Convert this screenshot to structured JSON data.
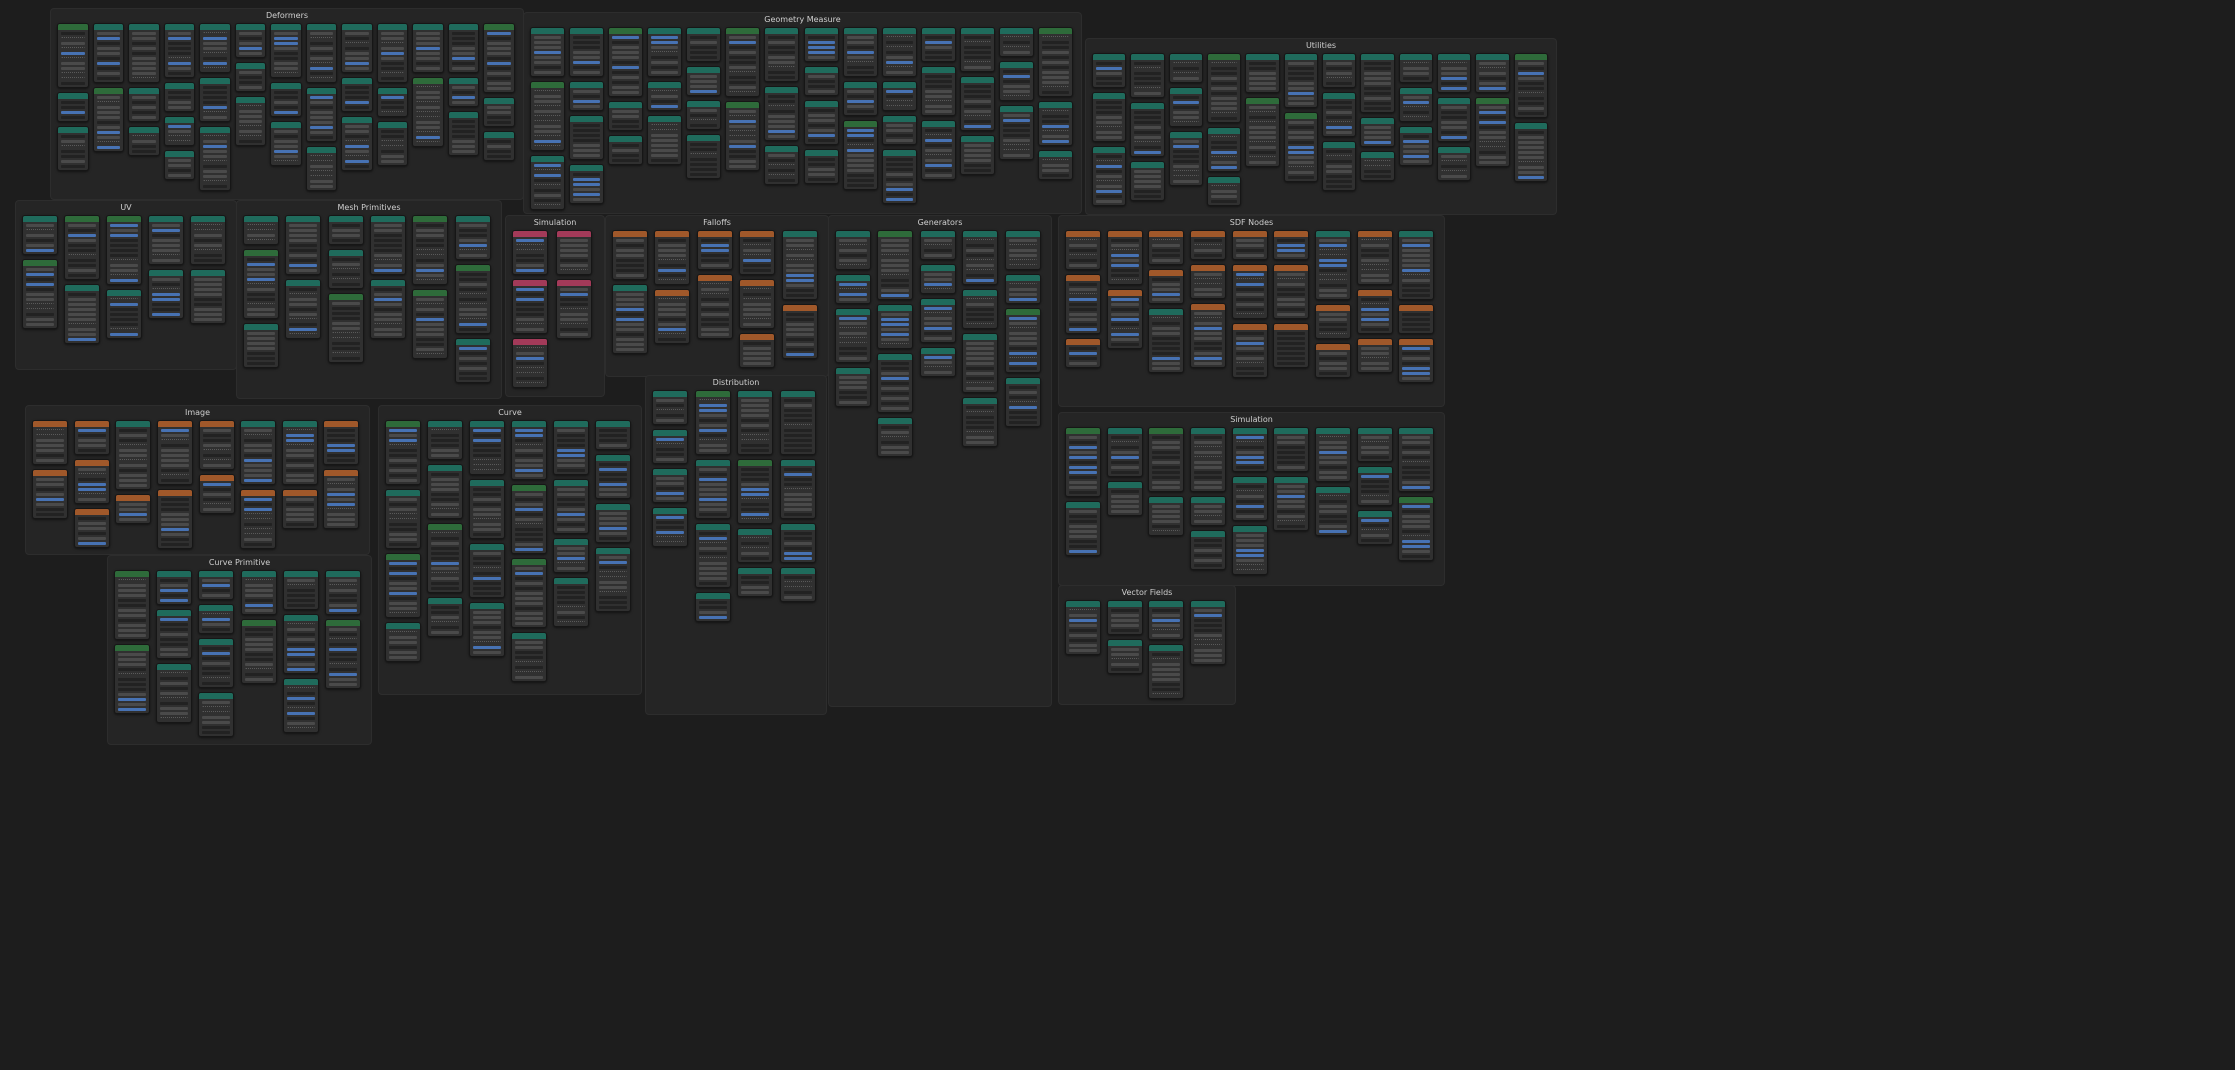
{
  "canvas": {
    "frames": [
      {
        "title": "Deformers"
      },
      {
        "title": "Geometry Measure"
      },
      {
        "title": "Utilities"
      },
      {
        "title": "UV"
      },
      {
        "title": "Mesh Primitives"
      },
      {
        "title": "Simulation"
      },
      {
        "title": "Falloffs"
      },
      {
        "title": "Generators"
      },
      {
        "title": "SDF Nodes"
      },
      {
        "title": "Distribution"
      },
      {
        "title": "Image"
      },
      {
        "title": "Curve"
      },
      {
        "title": "Simulation"
      },
      {
        "title": "Curve Primitive"
      },
      {
        "title": "Vector Fields"
      }
    ]
  },
  "colors": {
    "teal_header": "#1f6b5c",
    "green_header": "#2e6b3a",
    "orange_header": "#a0582a",
    "pink_header": "#a33a59",
    "blue_field": "#4772b3",
    "node_bg": "#303030",
    "frame_bg": "#252525",
    "canvas_bg": "#1d1d1d"
  }
}
